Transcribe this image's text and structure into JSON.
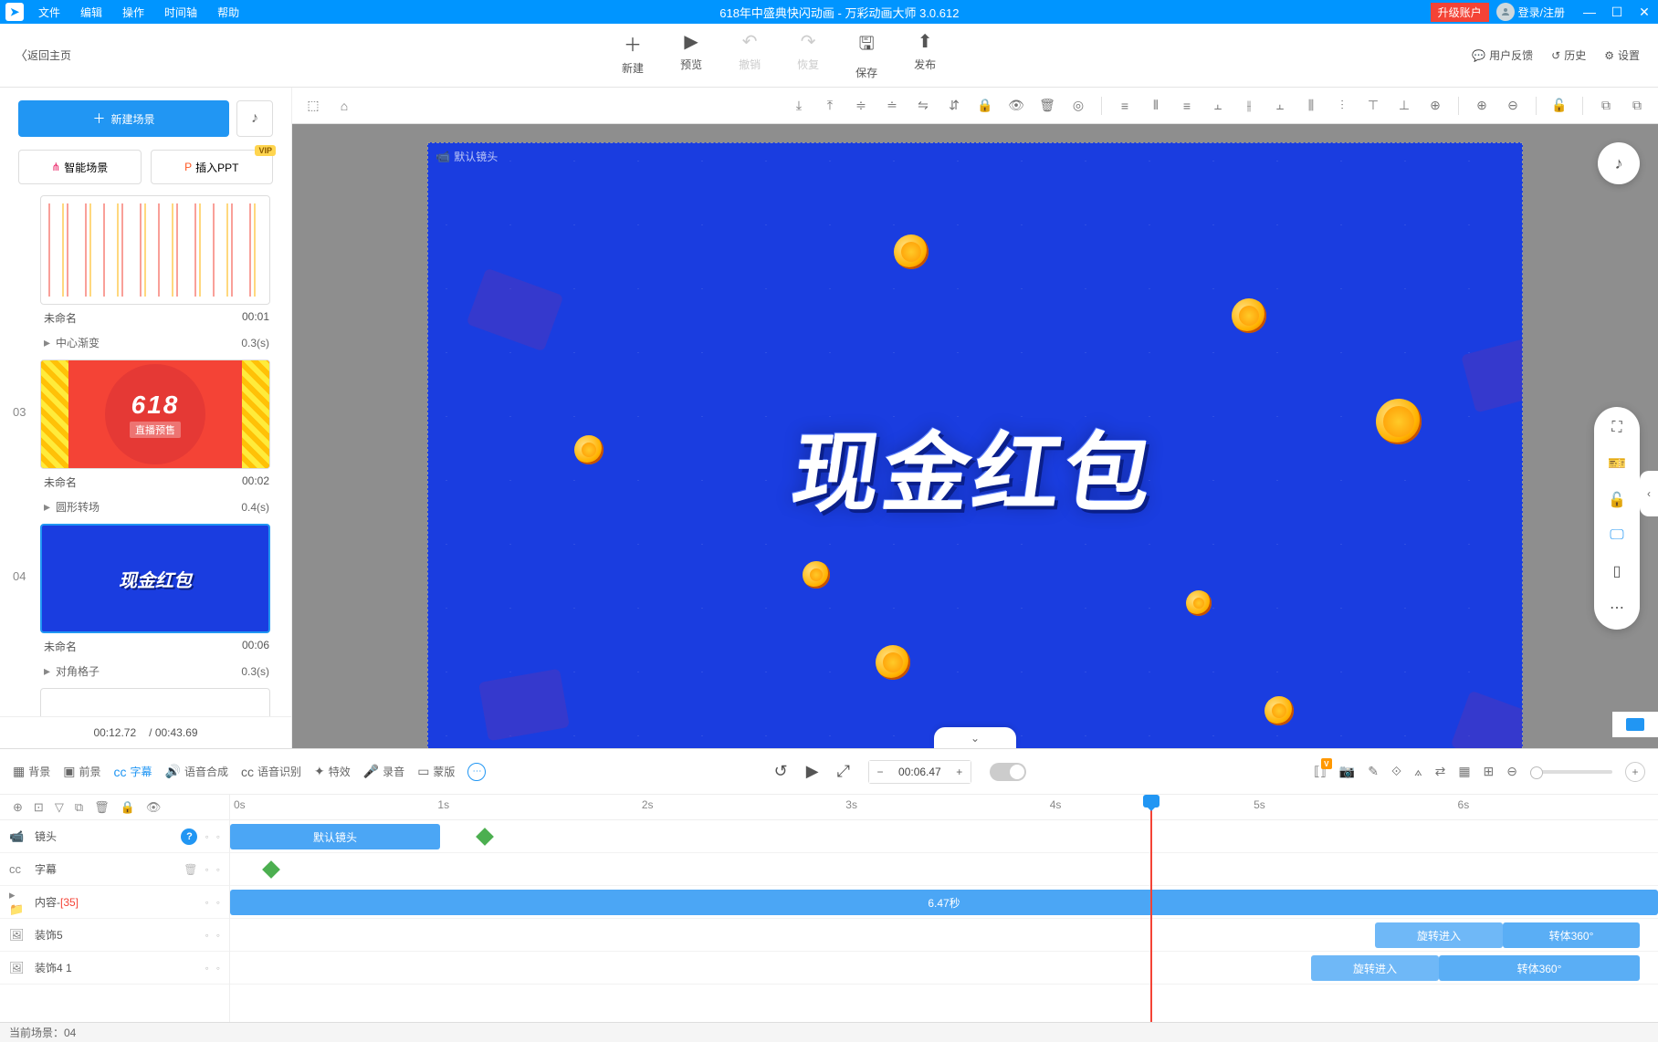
{
  "titlebar": {
    "menus": [
      "文件",
      "编辑",
      "操作",
      "时间轴",
      "帮助"
    ],
    "title": "618年中盛典快闪动画 - 万彩动画大师 3.0.612",
    "upgrade": "升级账户",
    "login": "登录/注册"
  },
  "maintb": {
    "back": "返回主页",
    "center": [
      {
        "icon": "＋",
        "label": "新建"
      },
      {
        "icon": "▶",
        "label": "预览"
      },
      {
        "icon": "↶",
        "label": "撤销",
        "dis": true
      },
      {
        "icon": "↷",
        "label": "恢复",
        "dis": true
      },
      {
        "icon": "🖫",
        "label": "保存"
      },
      {
        "icon": "⬆",
        "label": "发布"
      }
    ],
    "right": [
      {
        "icon": "💬",
        "label": "用户反馈"
      },
      {
        "icon": "↺",
        "label": "历史"
      },
      {
        "icon": "⚙",
        "label": "设置"
      }
    ]
  },
  "sidebar": {
    "newscene": "新建场景",
    "smart": "智能场景",
    "ppt": "插入PPT",
    "vip": "VIP",
    "scenes": [
      {
        "num": "",
        "name": "未命名",
        "dur": "00:01",
        "trans": "中心渐变",
        "tdur": "0.3(s)",
        "cls": "t1"
      },
      {
        "num": "03",
        "name": "未命名",
        "dur": "00:02",
        "trans": "圆形转场",
        "tdur": "0.4(s)",
        "cls": "t3"
      },
      {
        "num": "04",
        "name": "未命名",
        "dur": "00:06",
        "trans": "对角格子",
        "tdur": "0.3(s)",
        "cls": "t4",
        "sel": true
      }
    ],
    "thumb3": {
      "big": "618",
      "sm": "直播预售"
    },
    "thumb4": "现金红包",
    "curtime": "00:12.72",
    "tottime": "/ 00:43.69"
  },
  "canvas": {
    "tag": "默认镜头",
    "maintext": "现金红包"
  },
  "bottom": {
    "tabs": [
      {
        "icon": "▦",
        "label": "背景"
      },
      {
        "icon": "▣",
        "label": "前景"
      },
      {
        "icon": "cc",
        "label": "字幕",
        "act": true
      },
      {
        "icon": "🔊",
        "label": "语音合成"
      },
      {
        "icon": "cc",
        "label": "语音识别"
      },
      {
        "icon": "✦",
        "label": "特效"
      },
      {
        "icon": "🎤",
        "label": "录音"
      },
      {
        "icon": "▭",
        "label": "蒙版"
      }
    ],
    "time": "00:06.47",
    "ruler": [
      "0s",
      "1s",
      "2s",
      "3s",
      "4s",
      "5s",
      "6s"
    ],
    "tracks": {
      "camera": {
        "label": "镜头",
        "clip": "默认镜头"
      },
      "subtitle": {
        "label": "字幕"
      },
      "content": {
        "label": "内容-",
        "count": "[35]",
        "clip": "6.47秒"
      },
      "d1": {
        "label": "装饰5",
        "c1": "旋转进入",
        "c2": "转体360°"
      },
      "d2": {
        "label": "装饰4 1",
        "c1": "旋转进入",
        "c2": "转体360°"
      }
    }
  },
  "status": "当前场景：04"
}
